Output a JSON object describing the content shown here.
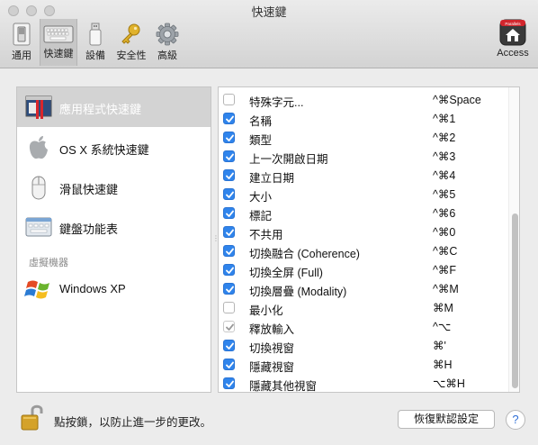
{
  "window": {
    "title": "快速鍵"
  },
  "toolbar": {
    "items": [
      {
        "label": "通用",
        "icon": "switch-icon"
      },
      {
        "label": "快速鍵",
        "icon": "keyboard-icon",
        "selected": true
      },
      {
        "label": "設備",
        "icon": "usb-drive-icon"
      },
      {
        "label": "安全性",
        "icon": "key-icon"
      },
      {
        "label": "高級",
        "icon": "gear-icon"
      }
    ],
    "access_label": "Access",
    "access_badge": "Parallels"
  },
  "sidebar": {
    "items": [
      {
        "label": "應用程式快速鍵",
        "icon": "app-window-icon",
        "selected": true
      },
      {
        "label": "OS X 系統快速鍵",
        "icon": "apple-icon"
      },
      {
        "label": "滑鼠快速鍵",
        "icon": "mouse-icon"
      },
      {
        "label": "鍵盤功能表",
        "icon": "keyboard-icon"
      }
    ],
    "section_header": "虛擬機器",
    "vm_items": [
      {
        "label": "Windows XP",
        "icon": "windows-icon"
      }
    ]
  },
  "shortcuts": [
    {
      "name": "特殊字元...",
      "keys": "^⌘Space",
      "checked": false
    },
    {
      "name": "名稱",
      "keys": "^⌘1",
      "checked": true
    },
    {
      "name": "類型",
      "keys": "^⌘2",
      "checked": true
    },
    {
      "name": "上一次開啟日期",
      "keys": "^⌘3",
      "checked": true
    },
    {
      "name": "建立日期",
      "keys": "^⌘4",
      "checked": true
    },
    {
      "name": "大小",
      "keys": "^⌘5",
      "checked": true
    },
    {
      "name": "標記",
      "keys": "^⌘6",
      "checked": true
    },
    {
      "name": "不共用",
      "keys": "^⌘0",
      "checked": true
    },
    {
      "name": "切換融合 (Coherence)",
      "keys": "^⌘C",
      "checked": true
    },
    {
      "name": "切換全屏 (Full)",
      "keys": "^⌘F",
      "checked": true
    },
    {
      "name": "切換層疊 (Modality)",
      "keys": "^⌘M",
      "checked": true
    },
    {
      "name": "最小化",
      "keys": "⌘M",
      "checked": false
    },
    {
      "name": "釋放輸入",
      "keys": "^⌥",
      "checked": true,
      "disabled": true
    },
    {
      "name": "切換視窗",
      "keys": "⌘'",
      "checked": true
    },
    {
      "name": "隱藏視窗",
      "keys": "⌘H",
      "checked": true
    },
    {
      "name": "隱藏其他視窗",
      "keys": "⌥⌘H",
      "checked": true
    }
  ],
  "footer": {
    "lock_text": "點按鎖，以防止進一步的更改。",
    "restore_label": "恢復默認設定",
    "help_label": "?"
  },
  "colors": {
    "checkbox_on": "#2f84ec",
    "selection": "#d3d3d3"
  }
}
